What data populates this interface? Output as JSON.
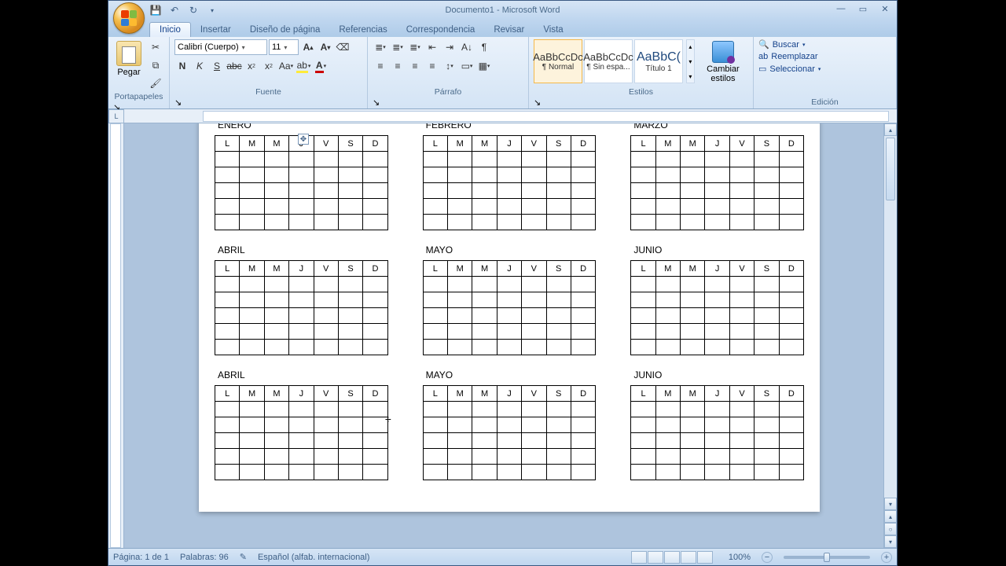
{
  "window": {
    "title_doc": "Documento1",
    "title_app": "Microsoft Word"
  },
  "tabs": [
    "Inicio",
    "Insertar",
    "Diseño de página",
    "Referencias",
    "Correspondencia",
    "Revisar",
    "Vista"
  ],
  "active_tab": 0,
  "clipboard": {
    "paste": "Pegar",
    "label": "Portapapeles"
  },
  "font": {
    "name": "Calibri (Cuerpo)",
    "size": "11",
    "label": "Fuente"
  },
  "paragraph": {
    "label": "Párrafo"
  },
  "styles": {
    "label": "Estilos",
    "items": [
      {
        "preview": "AaBbCcDc",
        "name": "¶ Normal"
      },
      {
        "preview": "AaBbCcDc",
        "name": "¶ Sin espa..."
      },
      {
        "preview": "AaBbC(",
        "name": "Título 1"
      }
    ],
    "change": "Cambiar estilos"
  },
  "editing": {
    "label": "Edición",
    "find": "Buscar",
    "replace": "Reemplazar",
    "select": "Seleccionar"
  },
  "document": {
    "months": [
      "ENERO",
      "FEBRERO",
      "MARZO",
      "ABRIL",
      "MAYO",
      "JUNIO",
      "ABRIL",
      "MAYO",
      "JUNIO"
    ],
    "day_headers": [
      "L",
      "M",
      "M",
      "J",
      "V",
      "S",
      "D"
    ]
  },
  "status": {
    "page": "Página: 1 de 1",
    "words": "Palabras: 96",
    "lang": "Español (alfab. internacional)",
    "zoom": "100%"
  }
}
